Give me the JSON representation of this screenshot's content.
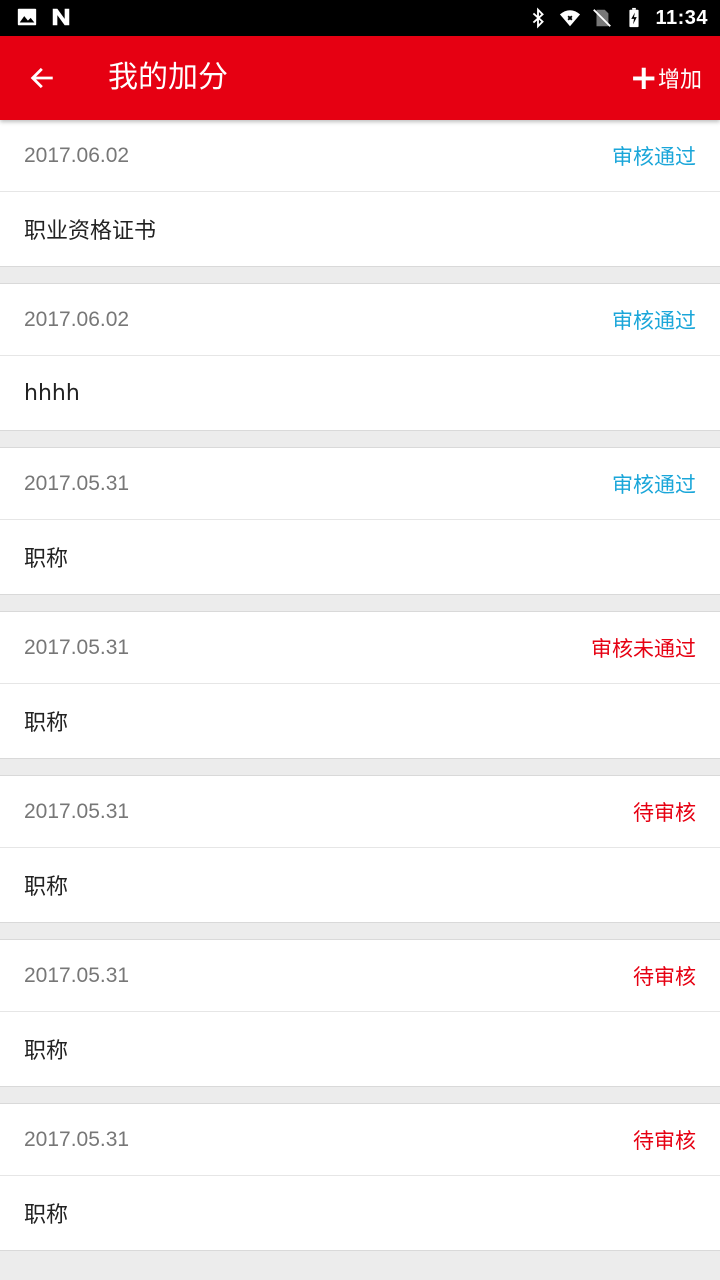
{
  "status_bar": {
    "time": "11:34",
    "left_icons": [
      "image-icon",
      "n-logo-icon"
    ],
    "right_icons": [
      "bluetooth-icon",
      "wifi-icon",
      "no-sim-icon",
      "battery-charging-icon"
    ]
  },
  "app_bar": {
    "title": "我的加分",
    "back_icon": "arrow-left-icon",
    "add_icon": "plus-icon",
    "add_label": "增加",
    "color": "#e60012"
  },
  "colors": {
    "approved": "#1aa6d9",
    "rejected": "#e60012",
    "pending": "#e60012"
  },
  "records": [
    {
      "date": "2017.06.02",
      "status": "审核通过",
      "status_type": "approved",
      "title": "职业资格证书"
    },
    {
      "date": "2017.06.02",
      "status": "审核通过",
      "status_type": "approved",
      "title": "hhhh"
    },
    {
      "date": "2017.05.31",
      "status": "审核通过",
      "status_type": "approved",
      "title": "职称"
    },
    {
      "date": "2017.05.31",
      "status": "审核未通过",
      "status_type": "rejected",
      "title": "职称"
    },
    {
      "date": "2017.05.31",
      "status": "待审核",
      "status_type": "pending",
      "title": "职称"
    },
    {
      "date": "2017.05.31",
      "status": "待审核",
      "status_type": "pending",
      "title": "职称"
    },
    {
      "date": "2017.05.31",
      "status": "待审核",
      "status_type": "pending",
      "title": "职称"
    }
  ]
}
